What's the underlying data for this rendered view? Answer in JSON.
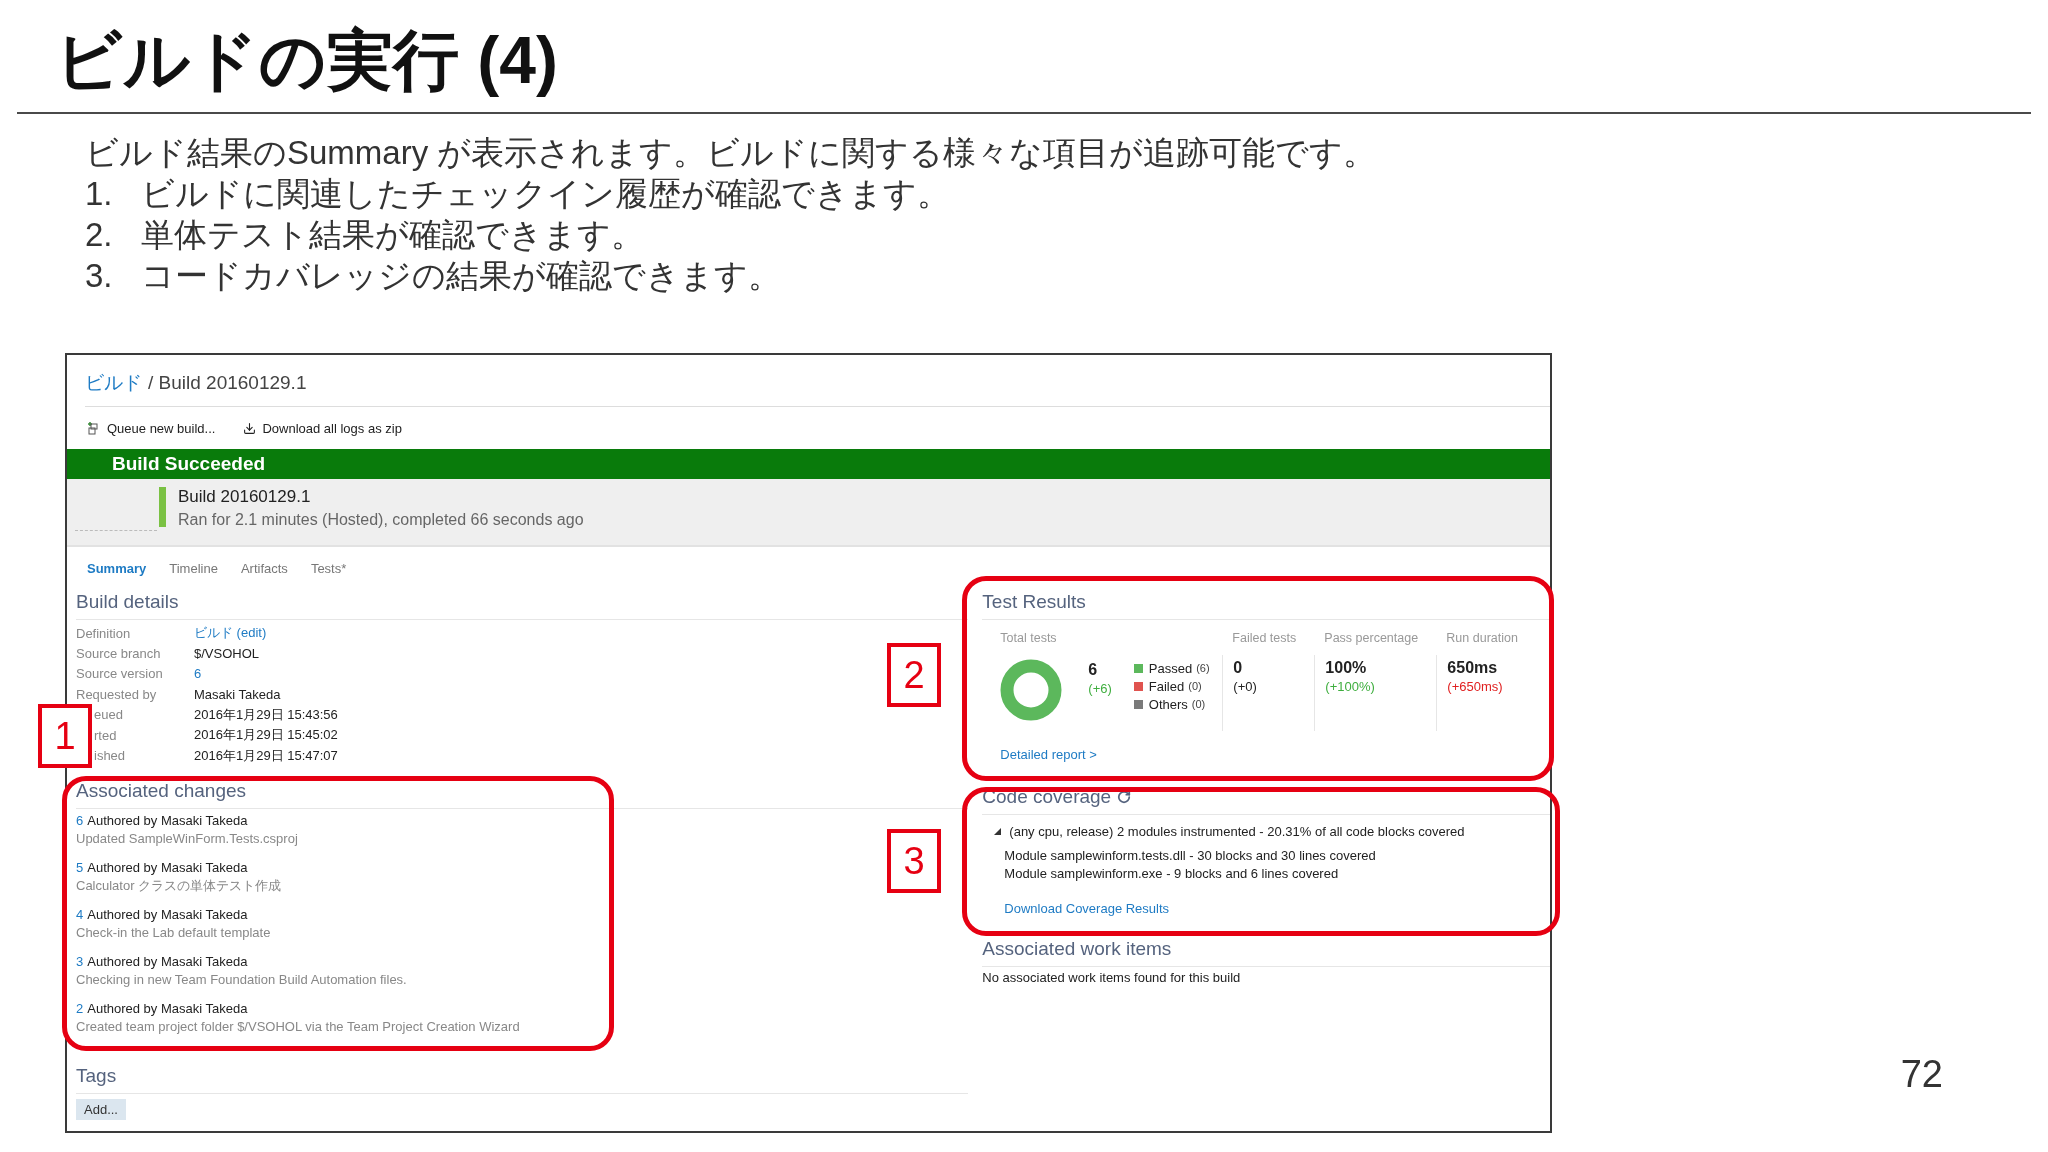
{
  "slide": {
    "title": "ビルドの実行 (4)",
    "intro": "ビルド結果のSummary が表示されます。ビルドに関する様々な項目が追跡可能です。",
    "points": [
      {
        "number": "1.",
        "text": "ビルドに関連したチェックイン履歴が確認できます。"
      },
      {
        "number": "2.",
        "text": "単体テスト結果が確認できます。"
      },
      {
        "number": "3.",
        "text": "コードカバレッジの結果が確認できます。"
      }
    ],
    "page_number": "72"
  },
  "breadcrumb": {
    "link": "ビルド",
    "current": "/ Build 20160129.1"
  },
  "toolbar": [
    {
      "kind": "queue",
      "label": "Queue new build..."
    },
    {
      "kind": "download",
      "label": "Download all logs as zip"
    }
  ],
  "status_banner": "Build Succeeded",
  "build_info": {
    "name": "Build 20160129.1",
    "summary": "Ran for 2.1 minutes (Hosted), completed 66 seconds ago"
  },
  "tabs": [
    {
      "label": "Summary",
      "selected": true
    },
    {
      "label": "Timeline",
      "selected": false
    },
    {
      "label": "Artifacts",
      "selected": false
    },
    {
      "label": "Tests*",
      "selected": false
    }
  ],
  "build_details": {
    "heading": "Build details",
    "rows": [
      {
        "label": "Definition",
        "value": "ビルド (edit)",
        "kind": "link",
        "partly_hidden": false
      },
      {
        "label": "Source branch",
        "value": "$/VSOHOL",
        "kind": "text",
        "partly_hidden": false
      },
      {
        "label": "Source version",
        "value": "6",
        "kind": "link",
        "partly_hidden": false
      },
      {
        "label": "Requested by",
        "value": "Masaki Takeda",
        "kind": "text",
        "partly_hidden": false
      },
      {
        "label": "eued",
        "value": "2016年1月29日 15:43:56",
        "kind": "text",
        "partly_hidden": true
      },
      {
        "label": "rted",
        "value": "2016年1月29日 15:45:02",
        "kind": "text",
        "partly_hidden": true
      },
      {
        "label": "ished",
        "value": "2016年1月29日 15:47:07",
        "kind": "text",
        "partly_hidden": true
      }
    ]
  },
  "associated_changes": {
    "heading": "Associated changes",
    "items": [
      {
        "id": "6",
        "author": "Authored by Masaki Takeda",
        "message": "Updated SampleWinForm.Tests.csproj"
      },
      {
        "id": "5",
        "author": "Authored by Masaki Takeda",
        "message": "Calculator クラスの単体テスト作成"
      },
      {
        "id": "4",
        "author": "Authored by Masaki Takeda",
        "message": "Check-in the Lab default template"
      },
      {
        "id": "3",
        "author": "Authored by Masaki Takeda",
        "message": "Checking in new Team Foundation Build Automation files."
      },
      {
        "id": "2",
        "author": "Authored by Masaki Takeda",
        "message": "Created team project folder $/VSOHOL via the Team Project Creation Wizard"
      }
    ]
  },
  "tags": {
    "heading": "Tags",
    "add_button": "Add..."
  },
  "test_results": {
    "heading": "Test Results",
    "total": {
      "label": "Total tests",
      "value": "6",
      "delta": "(+6)",
      "color": "#3fae3f"
    },
    "legend": [
      {
        "label": "Passed",
        "count": "(6)",
        "color": "#5cb85c"
      },
      {
        "label": "Failed",
        "count": "(0)",
        "color": "#e0534f"
      },
      {
        "label": "Others",
        "count": "(0)",
        "color": "#7a7a7a"
      }
    ],
    "metrics": [
      {
        "label": "Failed tests",
        "value": "0",
        "delta": "(+0)",
        "color": "#222222"
      },
      {
        "label": "Pass percentage",
        "value": "100%",
        "delta": "(+100%)",
        "color": "#3fae3f"
      },
      {
        "label": "Run duration",
        "value": "650ms",
        "delta": "(+650ms)",
        "color": "#e02020"
      }
    ],
    "link": "Detailed report >"
  },
  "code_coverage": {
    "heading": "Code coverage",
    "summary": "(any cpu, release) 2 modules instrumented - 20.31% of all code blocks covered",
    "modules": [
      "Module samplewinform.tests.dll - 30 blocks and 30 lines covered",
      "Module samplewinform.exe - 9 blocks and 6 lines covered"
    ],
    "link": "Download Coverage Results"
  },
  "work_items": {
    "heading": "Associated work items",
    "message": "No associated work items found for this build"
  },
  "callouts": [
    "1",
    "2",
    "3"
  ]
}
